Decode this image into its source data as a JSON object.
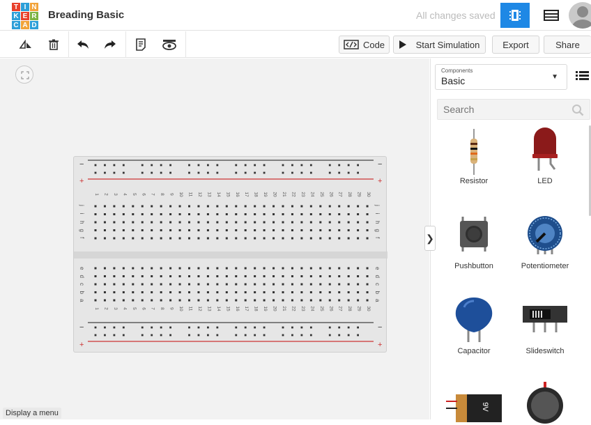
{
  "app": {
    "logo_letters": [
      "T",
      "I",
      "N",
      "K",
      "E",
      "R",
      "C",
      "A",
      "D"
    ],
    "logo_colors": [
      "#e8402b",
      "#2d9fd8",
      "#f1a33a",
      "#2d9fd8",
      "#e8402b",
      "#7cb342",
      "#2d9fd8",
      "#f1a33a",
      "#2d9fd8"
    ],
    "project_title": "Breading Basic",
    "save_status": "All changes saved"
  },
  "header": {
    "circuit_view_icon": "breadboard-icon",
    "schematic_view_icon": "list-view-icon",
    "accent": "#1e88e5"
  },
  "toolbar": {
    "code_label": "Code",
    "start_simulation_label": "Start Simulation",
    "export_label": "Export",
    "share_label": "Share"
  },
  "canvas": {
    "menu_hint": "Display a menu",
    "breadboard": {
      "columns": 30,
      "rows_top": [
        "j",
        "i",
        "h",
        "g",
        "f"
      ],
      "rows_bottom": [
        "e",
        "d",
        "c",
        "b",
        "a"
      ],
      "rail_minus": "−",
      "rail_plus": "+"
    }
  },
  "panel": {
    "components_label": "Components",
    "components_value": "Basic",
    "search_placeholder": "Search",
    "items": [
      {
        "label": "Resistor"
      },
      {
        "label": "LED"
      },
      {
        "label": "Pushbutton"
      },
      {
        "label": "Potentiometer"
      },
      {
        "label": "Capacitor"
      },
      {
        "label": "Slideswitch"
      }
    ],
    "battery_label": "9V"
  }
}
